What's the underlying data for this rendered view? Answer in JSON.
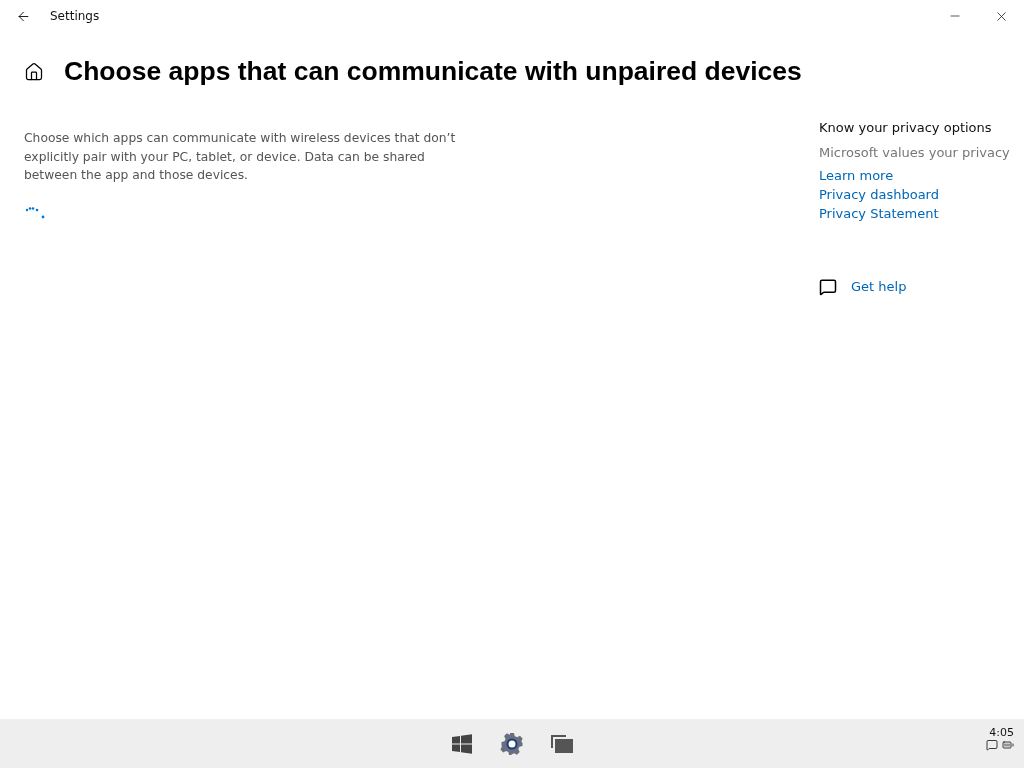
{
  "window": {
    "title": "Settings"
  },
  "page": {
    "heading": "Choose apps that can communicate with unpaired devices",
    "description": "Choose which apps can communicate with wireless devices that don’t explicitly pair with your PC, tablet, or device. Data can be shared between the app and those devices."
  },
  "side_panel": {
    "title": "Know your privacy options",
    "subtitle": "Microsoft values your privacy",
    "links": [
      "Learn more",
      "Privacy dashboard",
      "Privacy Statement"
    ],
    "help": "Get help"
  },
  "taskbar": {
    "clock": "4:05"
  }
}
